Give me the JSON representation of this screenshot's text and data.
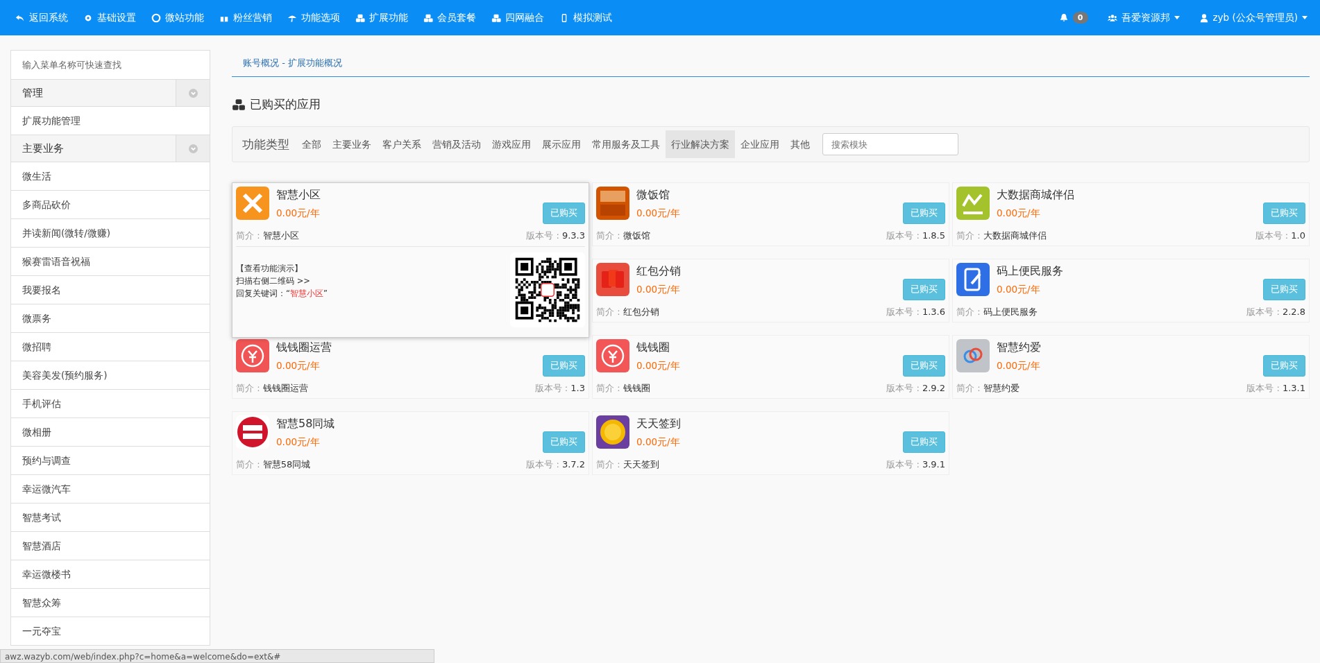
{
  "navbar": {
    "items": [
      {
        "label": "返回系统"
      },
      {
        "label": "基础设置"
      },
      {
        "label": "微站功能"
      },
      {
        "label": "粉丝营销"
      },
      {
        "label": "功能选项"
      },
      {
        "label": "扩展功能"
      },
      {
        "label": "会员套餐"
      },
      {
        "label": "四网融合"
      },
      {
        "label": "模拟测试"
      }
    ],
    "notifications": {
      "count": "0"
    },
    "account": {
      "label": "吾爱资源邦"
    },
    "user": {
      "label": "zyb (公众号管理员)"
    }
  },
  "sidebar": {
    "search": {
      "placeholder": "输入菜单名称可快速查找"
    },
    "groups": [
      {
        "title": "管理",
        "items": [
          "扩展功能管理"
        ]
      },
      {
        "title": "主要业务",
        "items": [
          "微生活",
          "多商品砍价",
          "并读新闻(微转/微赚)",
          "猴赛雷语音祝福",
          "我要报名",
          "微票务",
          "微招聘",
          "美容美发(预约服务)",
          "手机评估",
          "微相册",
          "预约与调查",
          "幸运微汽车",
          "智慧考试",
          "智慧酒店",
          "幸运微楼书",
          "智慧众筹",
          "一元夺宝"
        ]
      }
    ]
  },
  "breadcrumb": "账号概况 - 扩展功能概况",
  "section_title": "已购买的应用",
  "filter": {
    "label": "功能类型",
    "tabs": [
      {
        "label": "全部",
        "selected": false
      },
      {
        "label": "主要业务",
        "selected": false
      },
      {
        "label": "客户关系",
        "selected": false
      },
      {
        "label": "营销及活动",
        "selected": false
      },
      {
        "label": "游戏应用",
        "selected": false
      },
      {
        "label": "展示应用",
        "selected": false
      },
      {
        "label": "常用服务及工具",
        "selected": false
      },
      {
        "label": "行业解决方案",
        "selected": true
      },
      {
        "label": "企业应用",
        "selected": false
      },
      {
        "label": "其他",
        "selected": false
      }
    ],
    "search": {
      "placeholder": "搜索模块"
    }
  },
  "apps": [
    {
      "name": "智慧小区",
      "price": "0.00元/年",
      "button": "已购买",
      "desc_label": "简介 : ",
      "desc": "智慧小区",
      "version_label": "版本号 : ",
      "version": "9.3.3",
      "demo": {
        "title": "【查看功能演示】",
        "hint": "扫描右侧二维码 >>",
        "keyword_before": "回复关键词：“",
        "keyword": "智慧小区",
        "keyword_after": "”"
      }
    },
    {
      "name": "微饭馆",
      "price": "0.00元/年",
      "button": "已购买",
      "desc_label": "简介 : ",
      "desc": "微饭馆",
      "version_label": "版本号 : ",
      "version": "1.8.5"
    },
    {
      "name": "大数据商城伴侣",
      "price": "0.00元/年",
      "button": "已购买",
      "desc_label": "简介 : ",
      "desc": "大数据商城伴侣",
      "version_label": "版本号 : ",
      "version": "1.0"
    },
    {
      "name": "红包分销",
      "price": "0.00元/年",
      "button": "已购买",
      "desc_label": "简介 : ",
      "desc": "红包分销",
      "version_label": "版本号 : ",
      "version": "1.3.6"
    },
    {
      "name": "码上便民服务",
      "price": "0.00元/年",
      "button": "已购买",
      "desc_label": "简介 : ",
      "desc": "码上便民服务",
      "version_label": "版本号 : ",
      "version": "2.2.8"
    },
    {
      "name": "钱钱圈运营",
      "price": "0.00元/年",
      "button": "已购买",
      "desc_label": "简介 : ",
      "desc": "钱钱圈运营",
      "version_label": "版本号 : ",
      "version": "1.3"
    },
    {
      "name": "钱钱圈",
      "price": "0.00元/年",
      "button": "已购买",
      "desc_label": "简介 : ",
      "desc": "钱钱圈",
      "version_label": "版本号 : ",
      "version": "2.9.2"
    },
    {
      "name": "智慧约爱",
      "price": "0.00元/年",
      "button": "已购买",
      "desc_label": "简介 : ",
      "desc": "智慧约爱",
      "version_label": "版本号 : ",
      "version": "1.3.1"
    },
    {
      "name": "智慧58同城",
      "price": "0.00元/年",
      "button": "已购买",
      "desc_label": "简介 : ",
      "desc": "智慧58同城",
      "version_label": "版本号 : ",
      "version": "3.7.2"
    },
    {
      "name": "天天签到",
      "price": "0.00元/年",
      "button": "已购买",
      "desc_label": "简介 : ",
      "desc": "天天签到",
      "version_label": "版本号 : ",
      "version": "3.9.1"
    }
  ],
  "status_bar": "awz.wazyb.com/web/index.php?c=home&a=welcome&do=ext&#"
}
